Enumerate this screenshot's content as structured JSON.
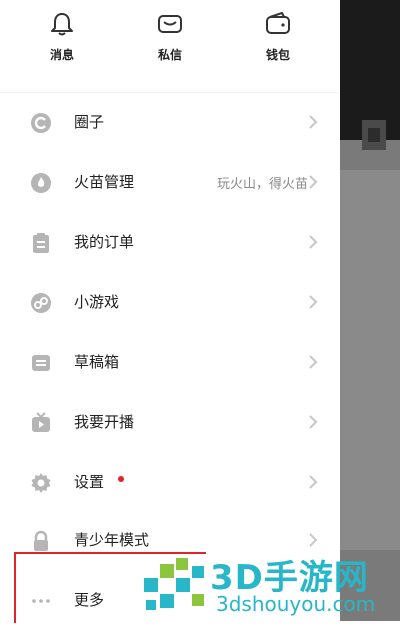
{
  "top_shortcuts": [
    {
      "label": "消息",
      "icon": "bell-icon"
    },
    {
      "label": "私信",
      "icon": "envelope-icon"
    },
    {
      "label": "钱包",
      "icon": "wallet-icon"
    }
  ],
  "menu": [
    {
      "label": "圈子",
      "icon": "circle-c-icon"
    },
    {
      "label": "火苗管理",
      "icon": "flame-icon",
      "hint": "玩火山，得火苗"
    },
    {
      "label": "我的订单",
      "icon": "clipboard-icon"
    },
    {
      "label": "小游戏",
      "icon": "game-icon"
    },
    {
      "label": "草稿箱",
      "icon": "draft-box-icon"
    },
    {
      "label": "我要开播",
      "icon": "live-tv-icon"
    },
    {
      "label": "设置",
      "icon": "gear-icon",
      "badge": "red-dot"
    },
    {
      "label": "青少年模式",
      "icon": "lock-icon"
    },
    {
      "label": "更多",
      "icon": "more-dots-icon"
    }
  ],
  "watermark": {
    "title": "3D手游网",
    "url": "3dshouyou.com"
  },
  "colors": {
    "icon_gray": "#b5b5b5",
    "accent_red": "#e0242a",
    "watermark_teal": "#27b7c8"
  }
}
